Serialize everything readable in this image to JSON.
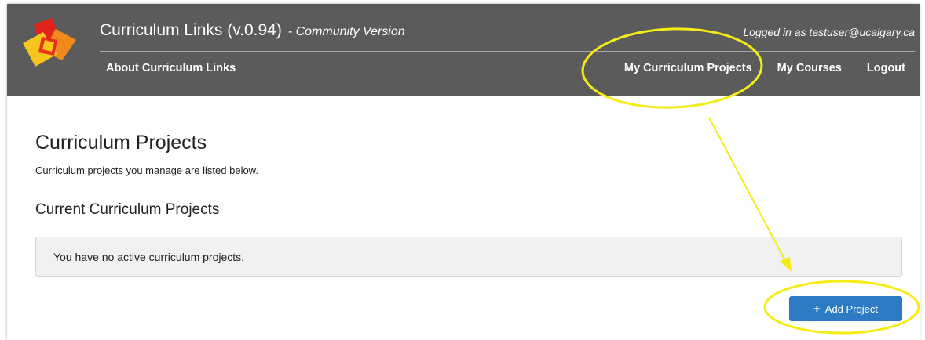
{
  "app": {
    "title": "Curriculum Links (v.0.94)",
    "version_tag": "- Community Version",
    "login_status": "Logged in as testuser@ucalgary.ca"
  },
  "nav": {
    "about": "About Curriculum Links",
    "my_projects": "My Curriculum Projects",
    "my_courses": "My Courses",
    "logout": "Logout"
  },
  "page": {
    "title": "Curriculum Projects",
    "intro": "Curriculum projects you manage are listed below.",
    "section_title": "Current Curriculum Projects",
    "empty_message": "You have no active curriculum projects.",
    "add_button": "Add Project"
  },
  "icons": {
    "logo": "curriculum-links-logo-icon",
    "add": "plus-icon"
  },
  "colors": {
    "header_bg": "#5b5b5b",
    "button_bg": "#2d7bc4",
    "annotation": "#f5ec16",
    "logo_yellow": "#f7c51e",
    "logo_orange": "#f08a1f",
    "logo_red": "#e2231a"
  }
}
